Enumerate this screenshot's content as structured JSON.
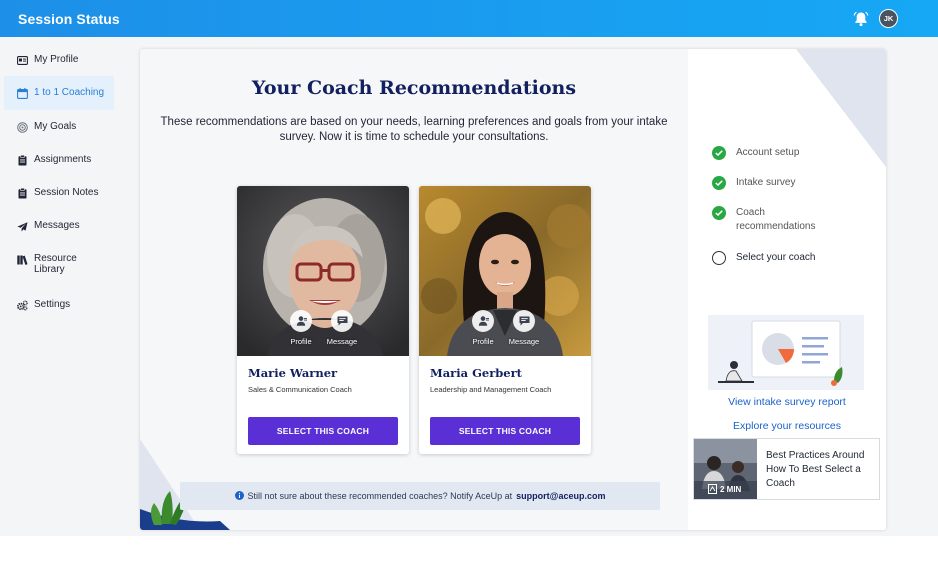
{
  "header": {
    "title": "Session Status",
    "avatar_initials": "JK"
  },
  "sidebar": {
    "items": [
      {
        "label": "My Profile",
        "icon": "id-card-icon"
      },
      {
        "label": "1 to 1 Coaching",
        "icon": "calendar-icon",
        "active": true
      },
      {
        "label": "My Goals",
        "icon": "target-icon"
      },
      {
        "label": "Assignments",
        "icon": "clipboard-icon"
      },
      {
        "label": "Session Notes",
        "icon": "clipboard-icon"
      },
      {
        "label": "Messages",
        "icon": "paper-plane-icon"
      },
      {
        "label": "Resource Library",
        "icon": "books-icon"
      },
      {
        "label": "Settings",
        "icon": "gears-icon"
      }
    ]
  },
  "main": {
    "heading": "Your Coach Recommendations",
    "subtext": "These recommendations are based on your needs, learning preferences and goals from your intake survey. Now it is time to schedule your consultations.",
    "coaches": [
      {
        "name": "Marie Warner",
        "role": "Sales & Communication Coach",
        "profile_label": "Profile",
        "message_label": "Message",
        "select_label": "SELECT THIS COACH"
      },
      {
        "name": "Maria Gerbert",
        "role": "Leadership and Management Coach",
        "profile_label": "Profile",
        "message_label": "Message",
        "select_label": "SELECT THIS COACH"
      }
    ],
    "notice": {
      "text": "Still not sure about these recommended coaches? Notify AceUp at",
      "email": "support@aceup.com"
    }
  },
  "progress": {
    "steps": [
      {
        "label": "Account setup",
        "done": true
      },
      {
        "label": "Intake survey",
        "done": true
      },
      {
        "label": "Coach recommendations",
        "done": true
      },
      {
        "label": "Select your coach",
        "done": false
      }
    ]
  },
  "resources": {
    "report_link": "View intake survey report",
    "explore_link": "Explore your resources",
    "video": {
      "title": "Best Practices Around How To Best Select a Coach",
      "duration": "2 MIN"
    }
  },
  "colors": {
    "brand_blue": "#1d8fe8",
    "navy": "#13205f",
    "button_purple": "#5a2fd5",
    "check_green": "#2aa745",
    "link_blue": "#1c62c8"
  }
}
